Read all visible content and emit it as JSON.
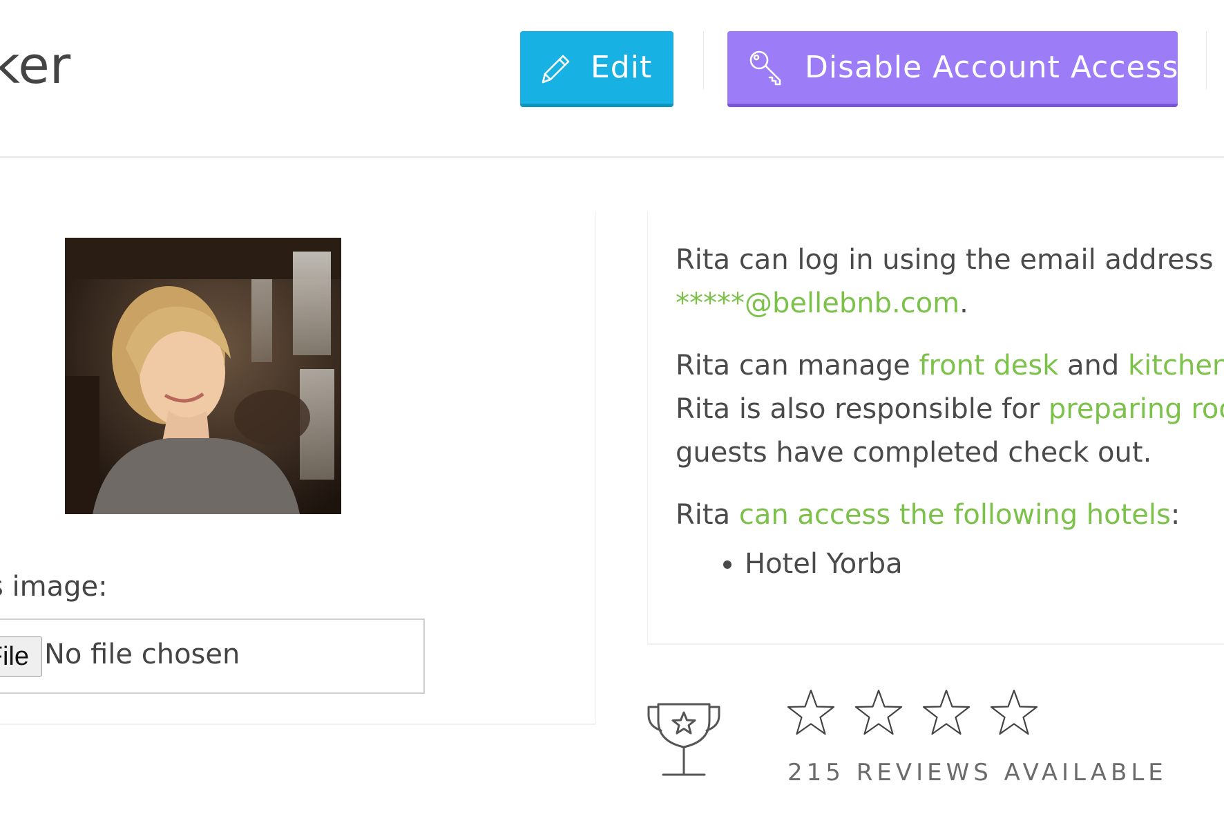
{
  "header": {
    "title_fragment": "ker",
    "edit_label": "Edit",
    "disable_label": "Disable Account Access"
  },
  "profile": {
    "image_label": "s image:",
    "file_button_label": "File",
    "file_status": "No file chosen"
  },
  "info": {
    "email_prefix": "Rita can log in using the email address",
    "email": "*****@bellebnb.com",
    "email_suffix": ".",
    "manage_prefix": "Rita can manage ",
    "role_1": "front desk",
    "manage_join": " and ",
    "role_2": "kitchen",
    "responsible_prefix": "Rita is also responsible for ",
    "responsibility": "preparing roo",
    "responsible_line2": "guests have completed check out.",
    "access_prefix": "Rita ",
    "access_link": "can access the following hotels",
    "access_suffix": ":",
    "hotels": [
      "Hotel Yorba"
    ]
  },
  "rating": {
    "stars_total": 4,
    "stars_filled": 0,
    "reviews_text": "215 REVIEWS AVAILABLE"
  },
  "colors": {
    "edit_button": "#17b1e3",
    "disable_button": "#9c7cf7",
    "link_green": "#7cc24a"
  }
}
